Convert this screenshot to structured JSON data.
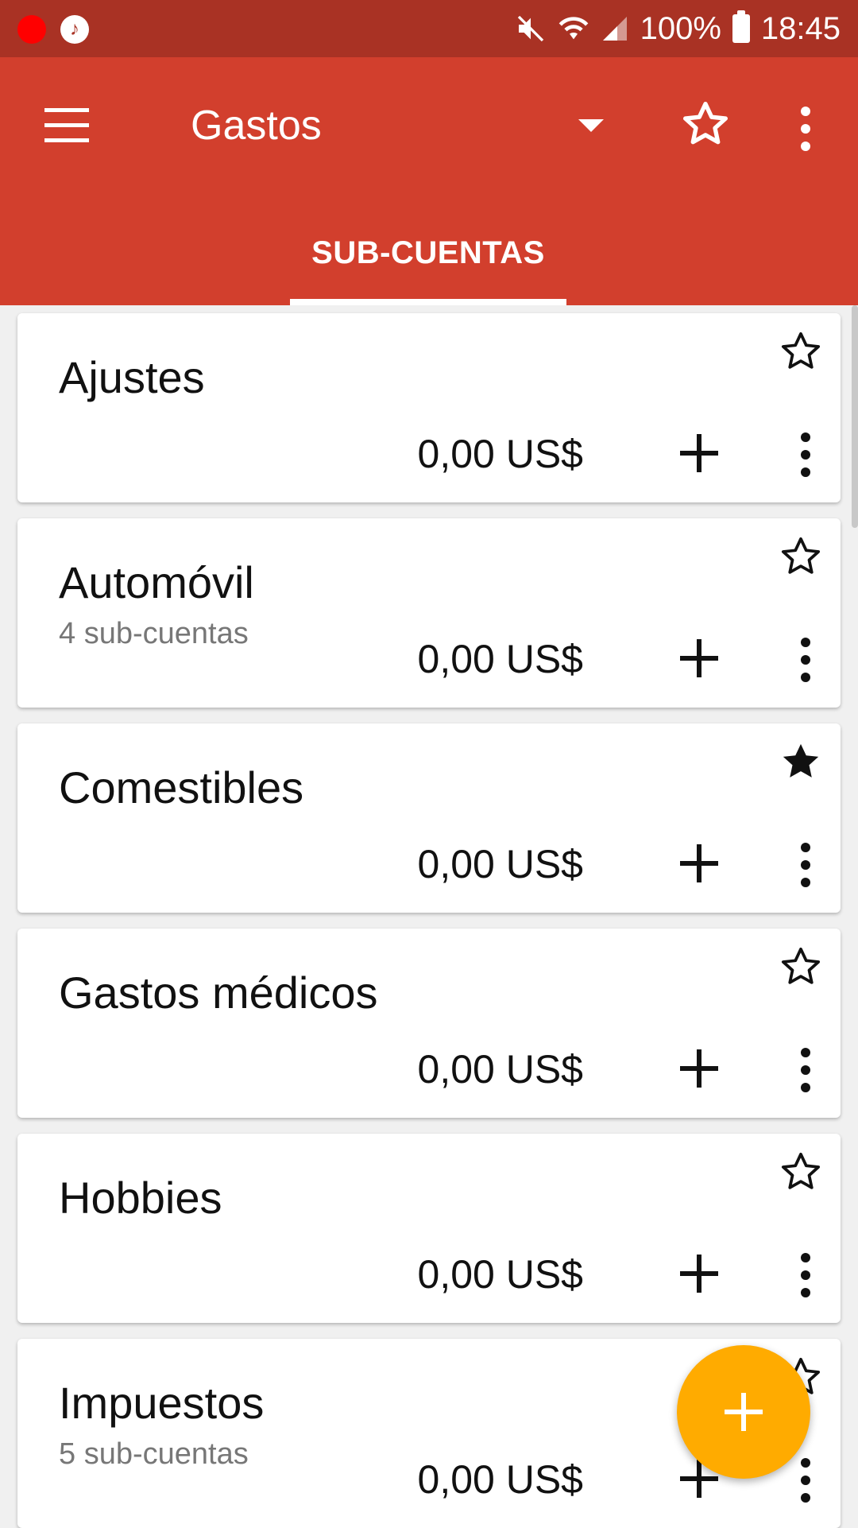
{
  "status_bar": {
    "battery": "100%",
    "time": "18:45",
    "icons": [
      "record-dot-icon",
      "music-note-icon",
      "mute-icon",
      "wifi-icon",
      "signal-icon",
      "battery-icon"
    ]
  },
  "app_bar": {
    "title": "Gastos",
    "tab": "SUB-CUENTAS",
    "icons": [
      "menu-icon",
      "dropdown-arrow-icon",
      "star-outline-icon",
      "overflow-menu-icon"
    ],
    "color": "#d23f2d"
  },
  "accounts": [
    {
      "name": "Ajustes",
      "sub": "",
      "amount": "0,00 US$",
      "favorite": false
    },
    {
      "name": "Automóvil",
      "sub": "4 sub-cuentas",
      "amount": "0,00 US$",
      "favorite": false
    },
    {
      "name": "Comestibles",
      "sub": "",
      "amount": "0,00 US$",
      "favorite": true
    },
    {
      "name": "Gastos médicos",
      "sub": "",
      "amount": "0,00 US$",
      "favorite": false
    },
    {
      "name": "Hobbies",
      "sub": "",
      "amount": "0,00 US$",
      "favorite": false
    },
    {
      "name": "Impuestos",
      "sub": "5 sub-cuentas",
      "amount": "0,00 US$",
      "favorite": false
    }
  ],
  "fab": {
    "icon": "add-icon",
    "color": "#ffab00"
  }
}
